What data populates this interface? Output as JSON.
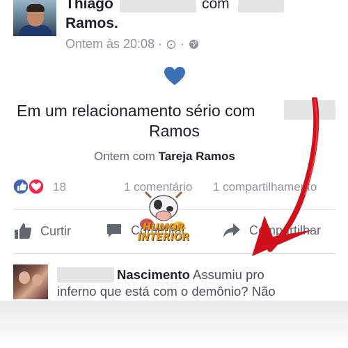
{
  "post": {
    "author_first": "Thiago",
    "connector": "com",
    "partner_last": "Ramos.",
    "timestamp": "Ontem às 20:08 ·",
    "status_line1": "Em um relacionamento sério com",
    "status_line2": "Ramos",
    "subline_prefix": "Ontem com",
    "subline_name": "Tareja Ramos"
  },
  "stats": {
    "reactions_count": "18",
    "comments": "1 comentário",
    "shares": "1 compartilhamento"
  },
  "actions": {
    "like": "Curtir",
    "comment": "Comentar",
    "share": "Compartilhar"
  },
  "comment": {
    "author_last": "Nascimento",
    "text_line1": "Assumiu pro",
    "text_line2": "inferno que está com o demônio? Não"
  },
  "watermark": {
    "line1": "HUMOR",
    "line2": "INTERIOR"
  },
  "colors": {
    "facebook_blue": "#4267b2",
    "heart_blue": "#3b6fb6",
    "arrow_red": "#d0111c",
    "love_red": "#f0284a"
  }
}
